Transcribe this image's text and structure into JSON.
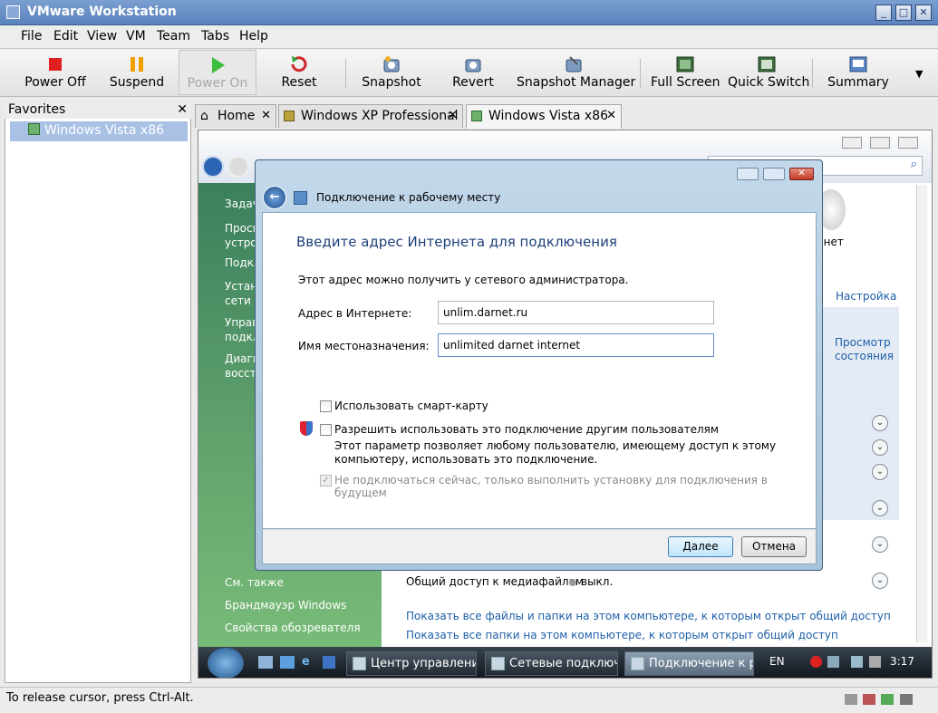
{
  "window": {
    "title": "VMware Workstation"
  },
  "menu": [
    "File",
    "Edit",
    "View",
    "VM",
    "Team",
    "Tabs",
    "Help"
  ],
  "toolbar": [
    {
      "label": "Power Off",
      "icon": "stop-icon"
    },
    {
      "label": "Suspend",
      "icon": "pause-icon"
    },
    {
      "label": "Power On",
      "icon": "play-icon"
    },
    {
      "label": "Reset",
      "icon": "reset-icon"
    },
    {
      "label": "Snapshot",
      "icon": "snapshot-icon"
    },
    {
      "label": "Revert",
      "icon": "revert-icon"
    },
    {
      "label": "Snapshot Manager",
      "icon": "snapshot-manager-icon"
    },
    {
      "label": "Full Screen",
      "icon": "full-screen-icon"
    },
    {
      "label": "Quick Switch",
      "icon": "quick-switch-icon"
    },
    {
      "label": "Summary",
      "icon": "summary-icon"
    }
  ],
  "favorites": {
    "title": "Favorites",
    "items": [
      "Windows Vista x86"
    ]
  },
  "tabs": [
    "Home",
    "Windows XP Professional",
    "Windows Vista x86"
  ],
  "guest": {
    "left_items": [
      "Задач",
      "Просм устро",
      "Подкл",
      "Устан сети",
      "Управ подкл",
      "Диагн восста"
    ],
    "see_also": "См. также",
    "see_also_links": [
      "Брандмауэр Windows",
      "Свойства обозревателя"
    ],
    "right_links": [
      "Настройка",
      "Просмотр состояния"
    ],
    "internet_label": "рнет",
    "media_label": "Общий доступ к медиафайлам",
    "media_value": "выкл.",
    "bottom_links": [
      "Показать все файлы и папки на этом компьютере, к которым открыт общий доступ",
      "Показать все папки на этом компьютере, к которым открыт общий доступ"
    ]
  },
  "dialog": {
    "title": "Подключение к рабочему месту",
    "heading": "Введите адрес Интернета для подключения",
    "hint": "Этот адрес можно получить у сетевого администратора.",
    "address_label": "Адрес в Интернете:",
    "address_value": "unlim.darnet.ru",
    "dest_label": "Имя местоназначения:",
    "dest_value": "unlimited darnet internet",
    "smartcard": "Использовать смарт-карту",
    "allow_others": "Разрешить использовать это подключение другим пользователям",
    "allow_desc1": "Этот параметр позволяет любому пользователю, имеющему доступ к этому",
    "allow_desc2": "компьютеру, использовать это подключение.",
    "no_connect": "Не подключаться сейчас, только выполнить установку для подключения в будущем",
    "next": "Далее",
    "cancel": "Отмена"
  },
  "taskbar": {
    "tasks": [
      "Центр управлени...",
      "Сетевые подключ...",
      "Подключение к р..."
    ],
    "lang": "EN",
    "time": "3:17"
  },
  "status": "To release cursor, press Ctrl-Alt."
}
